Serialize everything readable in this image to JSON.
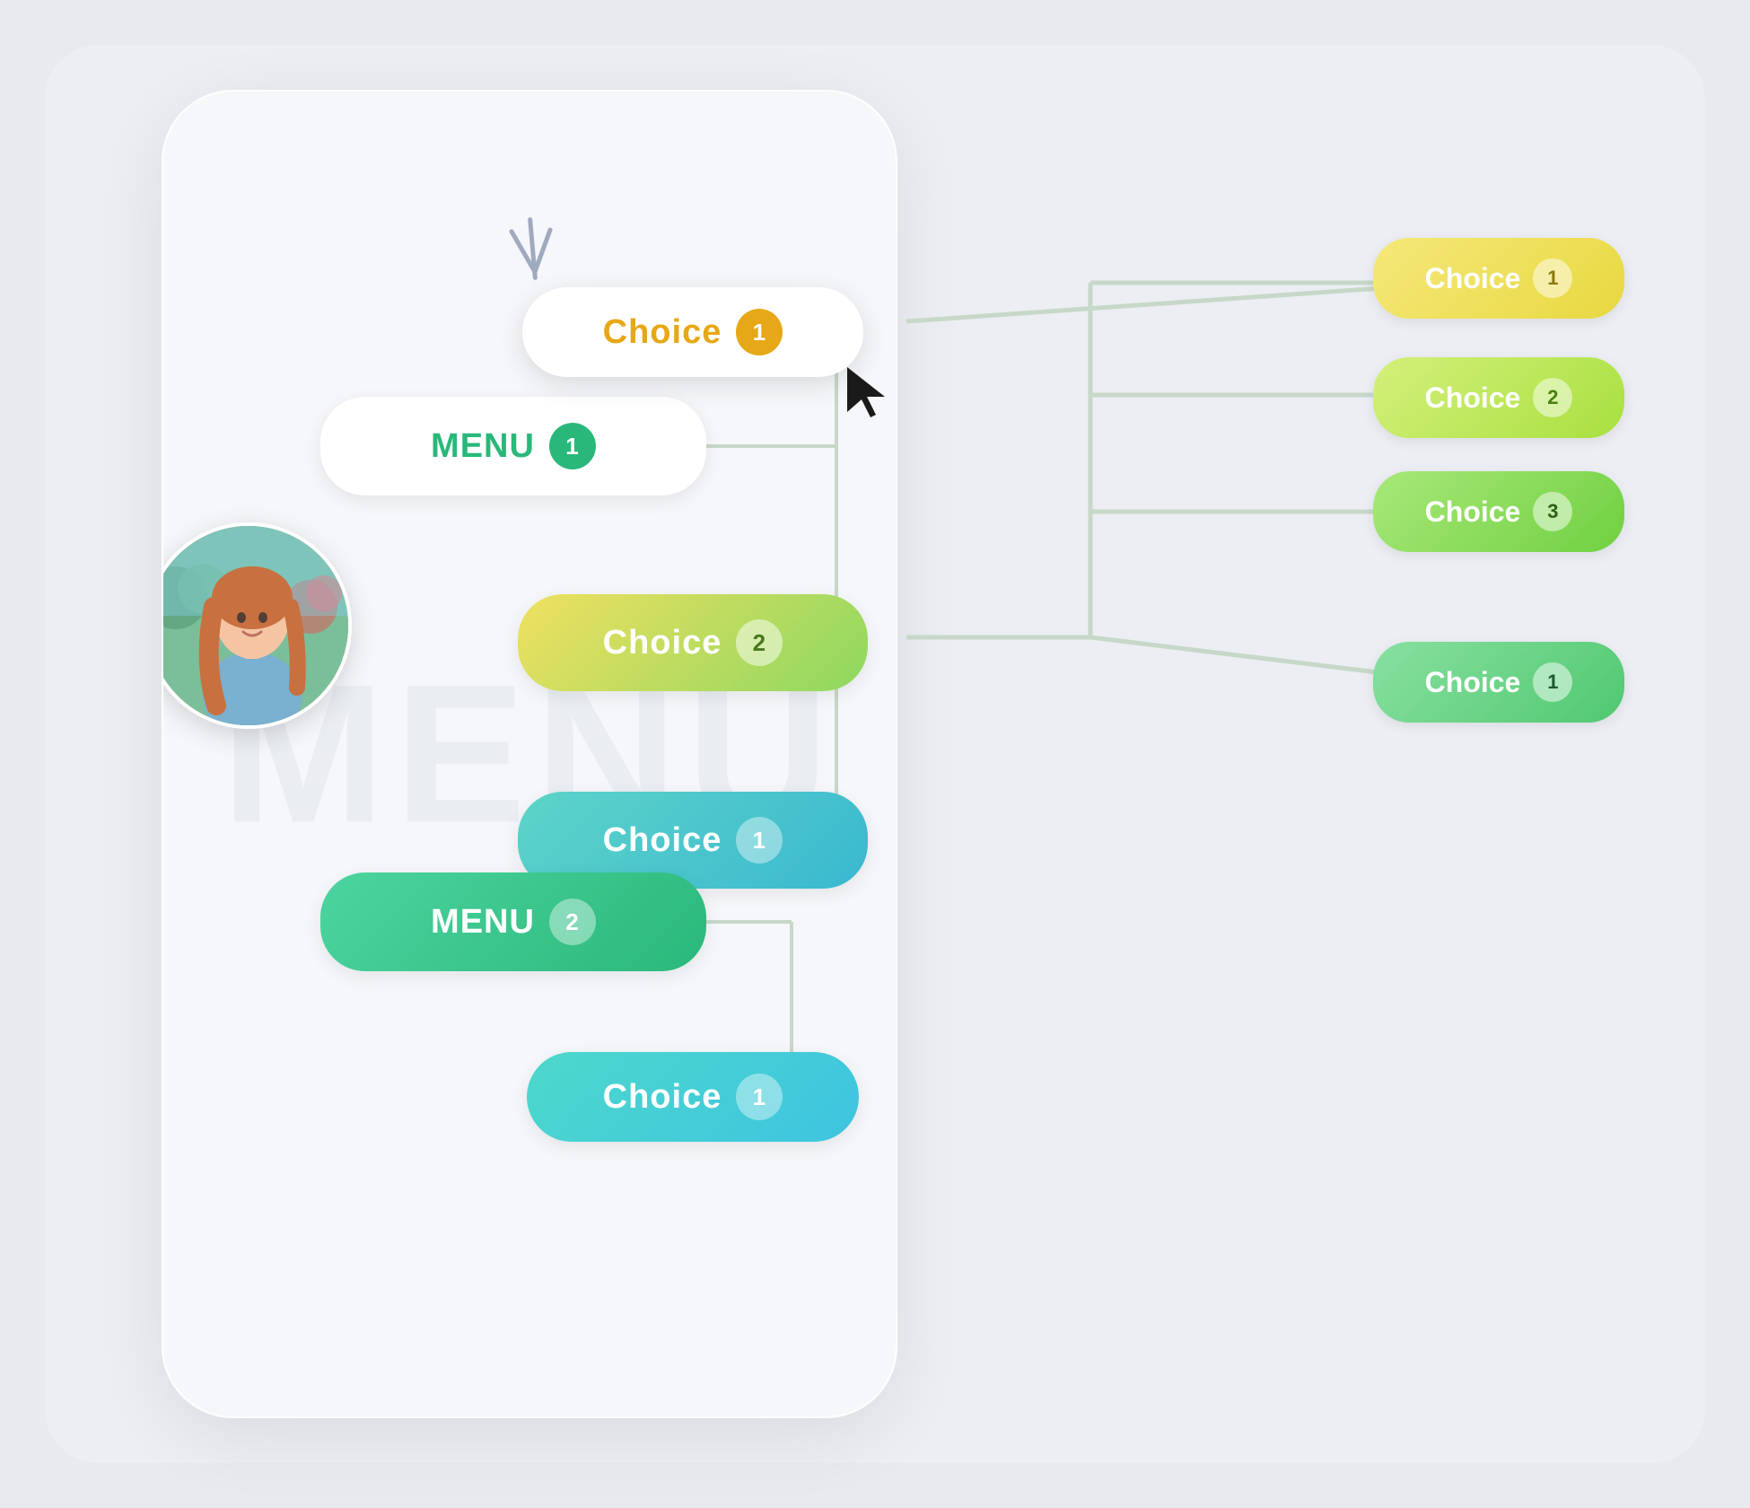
{
  "menu": {
    "menu1_label": "MENU",
    "menu1_badge": "1",
    "menu2_label": "MENU",
    "menu2_badge": "2"
  },
  "choices": {
    "choice1_top_label": "Choice",
    "choice1_top_badge": "1",
    "choice2_mid_label": "Choice",
    "choice2_mid_badge": "2",
    "choice3_lower_label": "Choice",
    "choice3_lower_badge": "1",
    "choice_next_label": "Choice",
    "choice_next_badge": "1"
  },
  "right_choices": [
    {
      "label": "Choice",
      "badge": "1",
      "bg_start": "#f5e87a",
      "bg_end": "#e8d840"
    },
    {
      "label": "Choice",
      "badge": "2",
      "bg_start": "#d4f07a",
      "bg_end": "#a8e040"
    },
    {
      "label": "Choice",
      "badge": "3",
      "bg_start": "#a8e87a",
      "bg_end": "#70d040"
    },
    {
      "label": "Choice",
      "badge": "1",
      "bg_start": "#88e0a0",
      "bg_end": "#50c870"
    }
  ],
  "menu_bg_text": "MENU",
  "colors": {
    "menu1_text": "#2ab87a",
    "menu1_badge_bg": "#2ab87a",
    "choice1_text": "#e6a817",
    "choice1_badge_bg": "#e6a817",
    "accent_green": "#2ab87a",
    "accent_teal": "#3ab8d0",
    "accent_yellow_green": "#8dd860"
  }
}
